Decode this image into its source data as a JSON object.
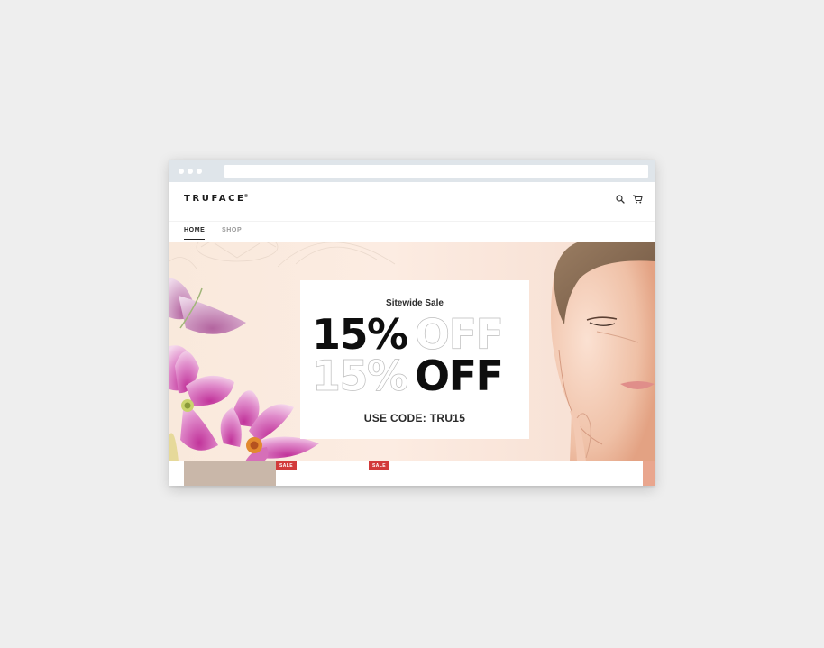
{
  "site": {
    "brand": "TRUFACE",
    "brand_mark": "®",
    "icons": [
      "search-icon",
      "cart-icon"
    ]
  },
  "nav": {
    "items": [
      {
        "label": "HOME",
        "active": true
      },
      {
        "label": "SHOP",
        "active": false
      }
    ]
  },
  "hero": {
    "subtitle": "Sitewide Sale",
    "line1_solid": "15%",
    "line1_outline": "OFF",
    "line2_outline": "15%",
    "line2_solid": "OFF",
    "code_text": "USE CODE: TRU15"
  },
  "products": {
    "badges": [
      "SALE",
      "SALE"
    ]
  },
  "colors": {
    "page_bg": "#eeeeee",
    "chrome": "#dfe5ea",
    "hero_bg": "#fcece2",
    "sale_badge": "#d23a3a",
    "text_dark": "#0e0e0e"
  }
}
